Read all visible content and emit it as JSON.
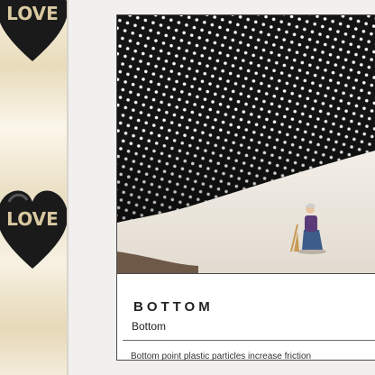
{
  "left_banner": {
    "heart_text": "LOVE"
  },
  "product": {
    "image_alt": "Close-up of mat underside with white dot particles and a miniature cleaner figure",
    "title": "BOTTOM",
    "subtitle": "Bottom",
    "description": "Bottom point plastic particles increase friction"
  },
  "colors": {
    "page_bg": "#f1f0ee",
    "card_border": "#4a4a4a",
    "mat_dark": "#141414",
    "dots": "#ffffff",
    "fur": "#e9e4dc"
  }
}
